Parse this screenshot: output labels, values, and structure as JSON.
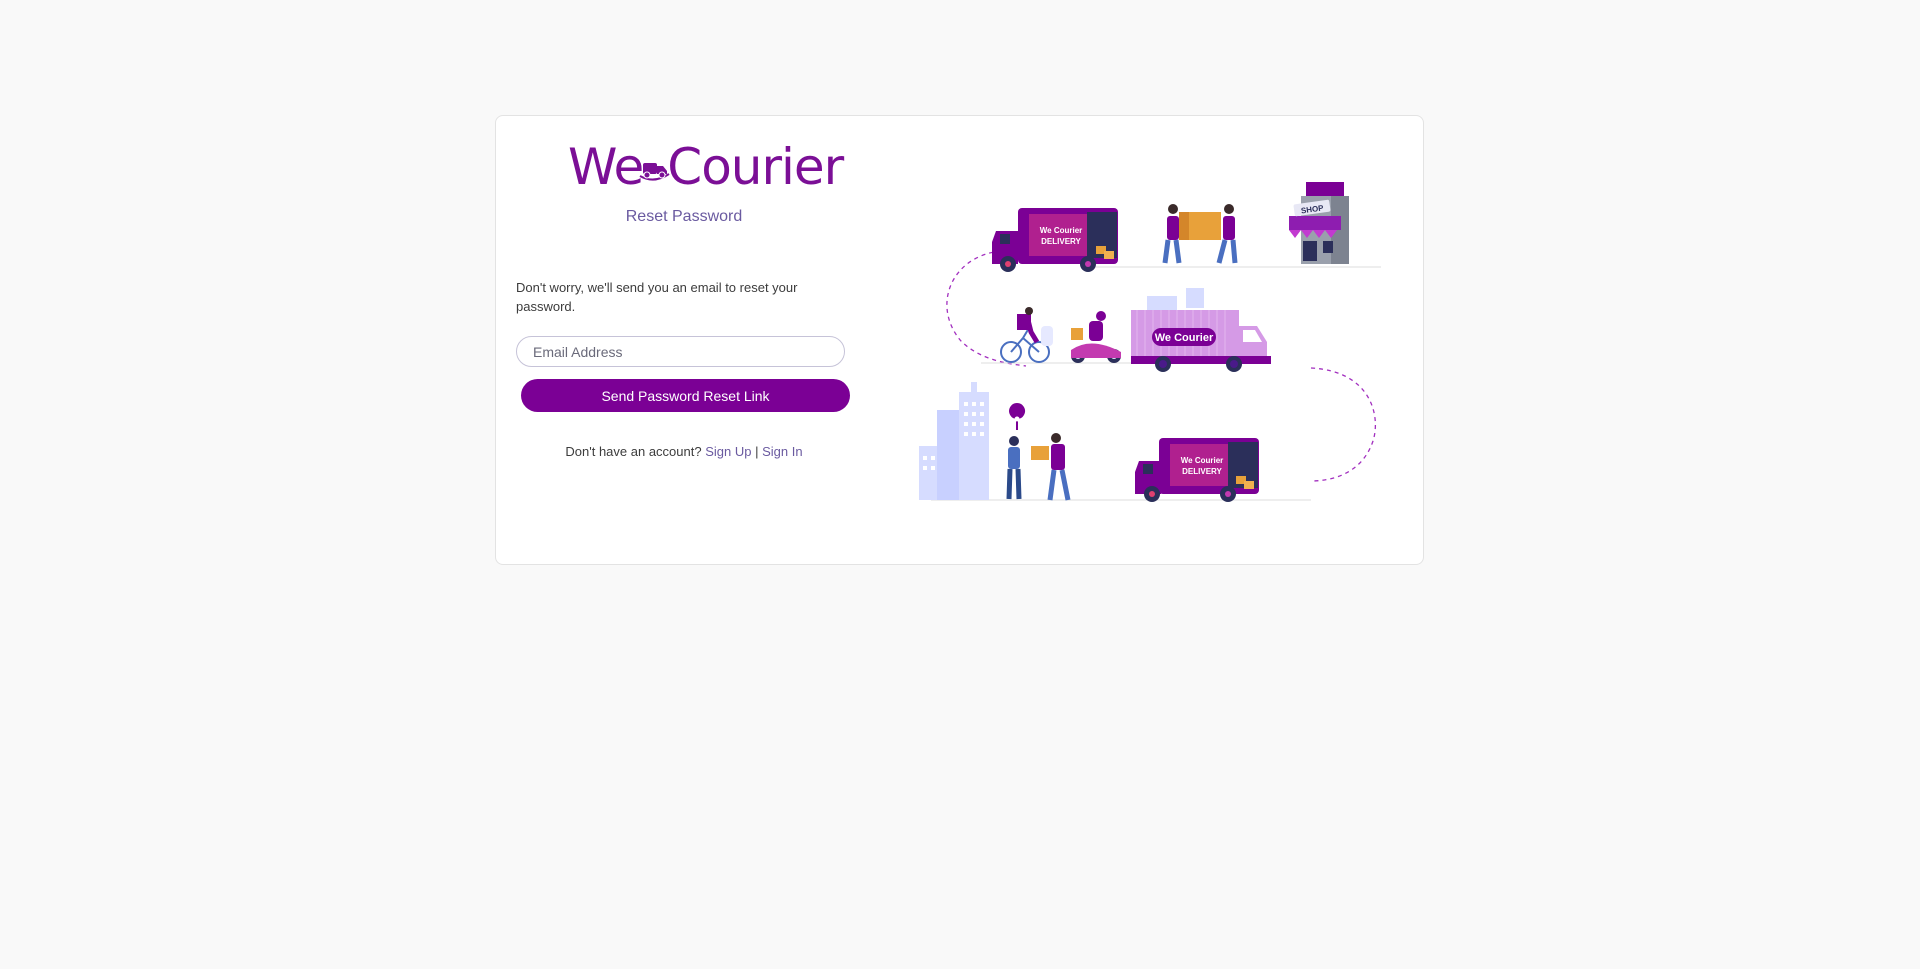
{
  "brand": {
    "logo_we": "We",
    "logo_courier": "Courier",
    "color": "#7b0f96"
  },
  "page": {
    "subtitle": "Reset Password",
    "description": "Don't worry, we'll send you an email to reset your password."
  },
  "form": {
    "email_placeholder": "Email Address",
    "email_value": "",
    "submit_label": "Send Password Reset Link"
  },
  "footer": {
    "prompt": "Don't have an account?",
    "signup_label": "Sign Up",
    "separator": "|",
    "signin_label": "Sign In"
  },
  "illustration": {
    "truck_label_line1": "We Courier",
    "truck_label_line2": "DELIVERY",
    "box_truck_label": "We Courier",
    "shop_sign": "SHOP",
    "accent": "#7b0095",
    "light": "#d6dcff"
  }
}
